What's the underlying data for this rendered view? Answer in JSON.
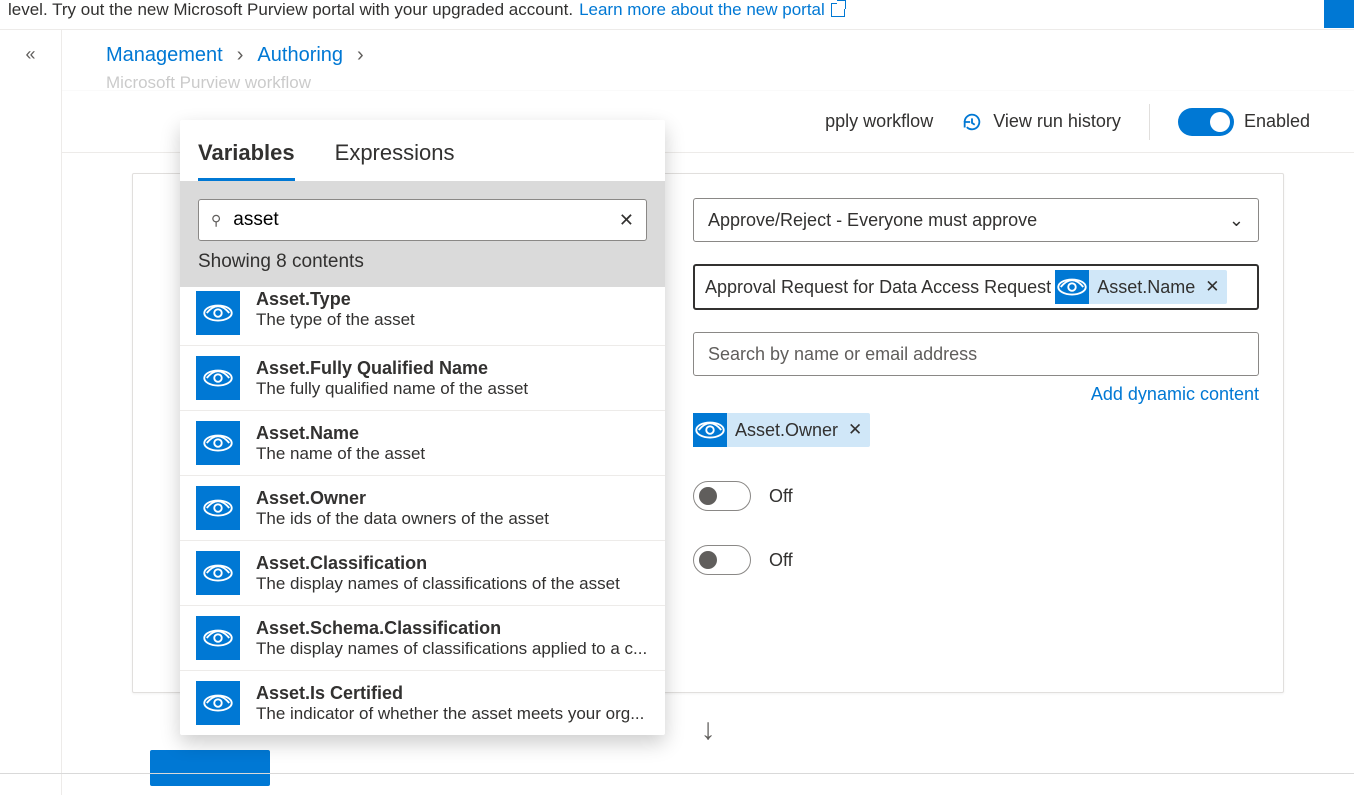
{
  "banner": {
    "text": "level. Try out the new Microsoft Purview portal with your upgraded account.",
    "link": "Learn more about the new portal"
  },
  "breadcrumb": {
    "a": "Management",
    "b": "Authoring"
  },
  "subline": "Microsoft Purview workflow",
  "toolbar": {
    "apply": "pply workflow",
    "history": "View run history",
    "enabled": "Enabled"
  },
  "card": {
    "approval_type": "Approve/Reject - Everyone must approve",
    "title_prefix": "Approval Request for Data Access Request",
    "title_token": "Asset.Name",
    "assigned_placeholder": "Search by name or email address",
    "dynamic": "Add dynamic content",
    "owner_token": "Asset.Owner",
    "off": "Off"
  },
  "popup": {
    "tabs": {
      "vars": "Variables",
      "expr": "Expressions"
    },
    "search_value": "asset",
    "count": "Showing 8 contents",
    "items": [
      {
        "t": "Asset.Type",
        "d": "The type of the asset"
      },
      {
        "t": "Asset.Fully Qualified Name",
        "d": "The fully qualified name of the asset"
      },
      {
        "t": "Asset.Name",
        "d": "The name of the asset"
      },
      {
        "t": "Asset.Owner",
        "d": "The ids of the data owners of the asset"
      },
      {
        "t": "Asset.Classification",
        "d": "The display names of classifications of the asset"
      },
      {
        "t": "Asset.Schema.Classification",
        "d": "The display names of classifications applied to a c..."
      },
      {
        "t": "Asset.Is Certified",
        "d": "The indicator of whether the asset meets your org..."
      }
    ]
  }
}
